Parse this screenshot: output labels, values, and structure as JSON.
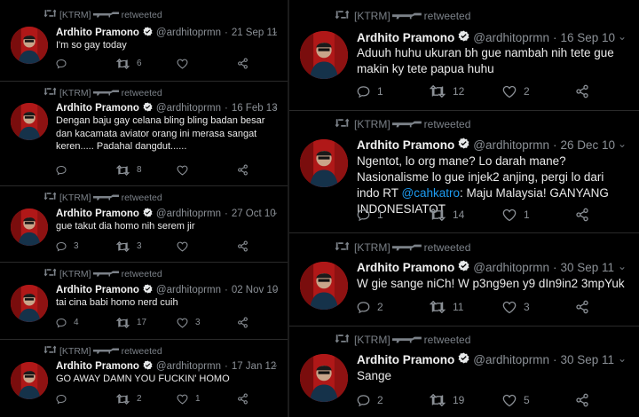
{
  "retweeter": "[KTRM]",
  "retweeted_label": "retweeted",
  "author": {
    "name": "Ardhito Pramono",
    "handle": "@ardhitoprmn",
    "dot": "·"
  },
  "left_column": [
    {
      "date": "21 Sep 11",
      "text": "I'm so gay today",
      "retweets": "6",
      "likes": ""
    },
    {
      "date": "16 Feb 13",
      "text": "Dengan baju gay celana bling bling badan besar dan kacamata aviator orang ini merasa sangat keren..... Padahal dangdut......",
      "retweets": "8",
      "likes": ""
    },
    {
      "date": "27 Oct 10",
      "text": "gue takut dia homo nih serem jir",
      "replies": "3",
      "retweets": "3",
      "likes": ""
    },
    {
      "date": "02 Nov 10",
      "text": "tai cina babi homo nerd cuih",
      "replies": "4",
      "retweets": "17",
      "likes": "3"
    },
    {
      "date": "17 Jan 12",
      "text": "GO AWAY DAMN YOU FUCKIN' HOMO",
      "retweets": "2",
      "likes": "1"
    }
  ],
  "right_column": [
    {
      "date": "16 Sep 10",
      "text": "Aduuh huhu ukuran bh gue nambah nih tete gue makin ky tete papua huhu",
      "replies": "1",
      "retweets": "12",
      "likes": "2"
    },
    {
      "date": "26 Dec 10",
      "text_before": "Ngentot, lo org mane? Lo darah mane? Nasionalisme lo gue injek2 anjing, pergi lo dari indo RT ",
      "mention": "@cahkatro",
      "text_after": ": Maju Malaysia! GANYANG INDONESIATOT",
      "replies": "1",
      "retweets": "14",
      "likes": "1"
    },
    {
      "date": "30 Sep 11",
      "text": "W gie sange niCh! W p3ng9en y9 dIn9in2 3mpYuk",
      "replies": "2",
      "retweets": "11",
      "likes": "3"
    },
    {
      "date": "30 Sep 11",
      "text": "Sange",
      "replies": "2",
      "retweets": "19",
      "likes": "5"
    }
  ],
  "colors": {
    "background": "#000000",
    "text": "#e7e9ea",
    "muted": "#8b9096",
    "mention": "#1d9bf0",
    "avatar": "#b01818"
  },
  "icons": [
    "retweet-icon",
    "rifle-icon",
    "verified-badge-icon",
    "chevron-down-icon",
    "reply-icon",
    "heart-icon",
    "share-icon"
  ]
}
